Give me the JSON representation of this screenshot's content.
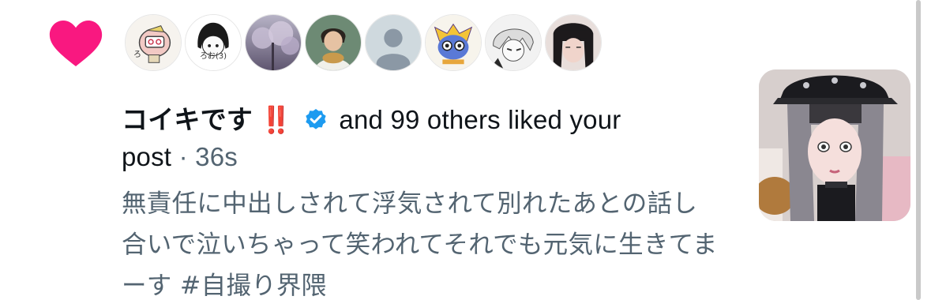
{
  "notification": {
    "icon": "heart-icon",
    "icon_color": "#f91880",
    "liker_name": "コイキです",
    "alert_emoji": "‼️",
    "verified_color": "#1d9bf0",
    "summary_text": "and 99 others liked your post",
    "separator": "·",
    "time": "36s",
    "post_text": "無責任に中出しされて浮気されて別れたあとの話し合いで泣いちゃって笑われてそれでも元気に生きてまーす #自撮り界隈"
  },
  "avatars": [
    {
      "name": "avatar-1",
      "caption": "ろ"
    },
    {
      "name": "avatar-2",
      "caption": "ろお(3)"
    },
    {
      "name": "avatar-3",
      "caption": ""
    },
    {
      "name": "avatar-4",
      "caption": ""
    },
    {
      "name": "avatar-5-default",
      "caption": ""
    },
    {
      "name": "avatar-6",
      "caption": ""
    },
    {
      "name": "avatar-7",
      "caption": ""
    },
    {
      "name": "avatar-8",
      "caption": ""
    }
  ]
}
